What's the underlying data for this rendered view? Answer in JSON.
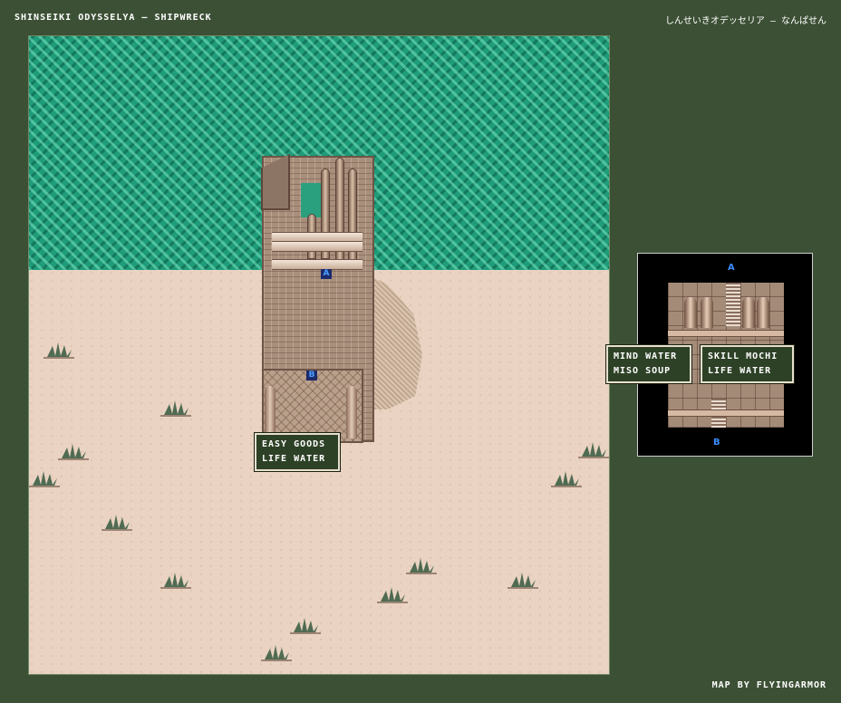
{
  "header": {
    "title": "SHINSEIKI ODYSSELYA – SHIPWRECK",
    "title_jp": "しんせいきオデッセリア – なんぱせん"
  },
  "credit": "MAP BY FLYINGARMOR",
  "main_map": {
    "markers": {
      "a": "A",
      "b": "B"
    },
    "shop_box": {
      "line1": "EASY GOODS",
      "line2": "LIFE WATER"
    }
  },
  "inset_map": {
    "markers": {
      "a": "A",
      "b": "B"
    },
    "left_box": {
      "line1": "MIND WATER",
      "line2": "MISO SOUP"
    },
    "right_box": {
      "line1": "SKILL MOCHI",
      "line2": "LIFE WATER"
    }
  },
  "colors": {
    "background": "#3c5035",
    "sea": "#1f9c7a",
    "sand": "#ead3c2",
    "label_box": "#2d4126",
    "marker": "#3b8cff"
  },
  "icons": [
    "desert-shrub-icon",
    "marker-a-icon",
    "marker-b-icon"
  ]
}
